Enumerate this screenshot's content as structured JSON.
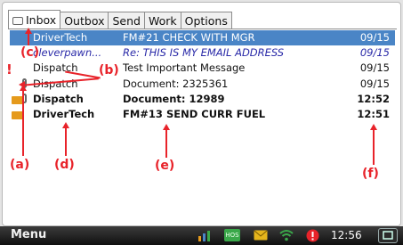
{
  "tabs": [
    {
      "label": "Inbox",
      "active": true
    },
    {
      "label": "Outbox",
      "active": false
    },
    {
      "label": "Send",
      "active": false
    },
    {
      "label": "Work",
      "active": false
    },
    {
      "label": "Options",
      "active": false
    }
  ],
  "messages": [
    {
      "from": "DriverTech",
      "subject": "FM#21 CHECK WITH MGR",
      "date": "09/15",
      "style": "selected"
    },
    {
      "from": "cleverpawn...",
      "subject": "Re: THIS IS MY EMAIL ADDRESS",
      "date": "09/15",
      "style": "italic"
    },
    {
      "from": "Dispatch",
      "subject": "Test Important Message",
      "date": "09/15",
      "style": "normal"
    },
    {
      "from": "Dispatch",
      "subject": "Document: 2325361",
      "date": "09/15",
      "style": "normal"
    },
    {
      "from": "Dispatch",
      "subject": "Document: 12989",
      "date": "12:52",
      "style": "bold"
    },
    {
      "from": "DriverTech",
      "subject": "FM#13 SEND CURR FUEL",
      "date": "12:51",
      "style": "bold"
    }
  ],
  "annotations": {
    "a": "(a)",
    "b": "(b)",
    "c": "(c)",
    "d": "(d)",
    "e": "(e)",
    "f": "(f)",
    "important_mark": "!"
  },
  "taskbar": {
    "menu_label": "Menu",
    "hos_label": "HOS",
    "clock": "12:56"
  },
  "colors": {
    "selected_row": "#4a85c6",
    "annotation": "#e8232a",
    "envelope": "#e59a1c",
    "italic_text": "#2a2aa8"
  }
}
